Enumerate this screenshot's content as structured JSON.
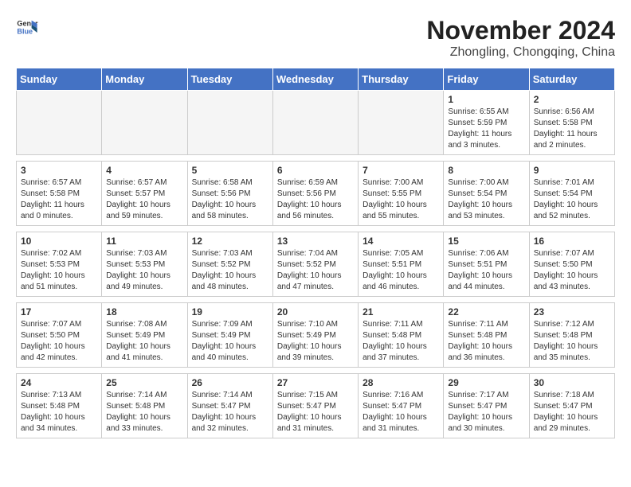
{
  "header": {
    "logo_general": "General",
    "logo_blue": "Blue",
    "month_year": "November 2024",
    "location": "Zhongling, Chongqing, China"
  },
  "weekdays": [
    "Sunday",
    "Monday",
    "Tuesday",
    "Wednesday",
    "Thursday",
    "Friday",
    "Saturday"
  ],
  "weeks": [
    [
      {
        "day": "",
        "info": ""
      },
      {
        "day": "",
        "info": ""
      },
      {
        "day": "",
        "info": ""
      },
      {
        "day": "",
        "info": ""
      },
      {
        "day": "",
        "info": ""
      },
      {
        "day": "1",
        "info": "Sunrise: 6:55 AM\nSunset: 5:59 PM\nDaylight: 11 hours\nand 3 minutes."
      },
      {
        "day": "2",
        "info": "Sunrise: 6:56 AM\nSunset: 5:58 PM\nDaylight: 11 hours\nand 2 minutes."
      }
    ],
    [
      {
        "day": "3",
        "info": "Sunrise: 6:57 AM\nSunset: 5:58 PM\nDaylight: 11 hours\nand 0 minutes."
      },
      {
        "day": "4",
        "info": "Sunrise: 6:57 AM\nSunset: 5:57 PM\nDaylight: 10 hours\nand 59 minutes."
      },
      {
        "day": "5",
        "info": "Sunrise: 6:58 AM\nSunset: 5:56 PM\nDaylight: 10 hours\nand 58 minutes."
      },
      {
        "day": "6",
        "info": "Sunrise: 6:59 AM\nSunset: 5:56 PM\nDaylight: 10 hours\nand 56 minutes."
      },
      {
        "day": "7",
        "info": "Sunrise: 7:00 AM\nSunset: 5:55 PM\nDaylight: 10 hours\nand 55 minutes."
      },
      {
        "day": "8",
        "info": "Sunrise: 7:00 AM\nSunset: 5:54 PM\nDaylight: 10 hours\nand 53 minutes."
      },
      {
        "day": "9",
        "info": "Sunrise: 7:01 AM\nSunset: 5:54 PM\nDaylight: 10 hours\nand 52 minutes."
      }
    ],
    [
      {
        "day": "10",
        "info": "Sunrise: 7:02 AM\nSunset: 5:53 PM\nDaylight: 10 hours\nand 51 minutes."
      },
      {
        "day": "11",
        "info": "Sunrise: 7:03 AM\nSunset: 5:53 PM\nDaylight: 10 hours\nand 49 minutes."
      },
      {
        "day": "12",
        "info": "Sunrise: 7:03 AM\nSunset: 5:52 PM\nDaylight: 10 hours\nand 48 minutes."
      },
      {
        "day": "13",
        "info": "Sunrise: 7:04 AM\nSunset: 5:52 PM\nDaylight: 10 hours\nand 47 minutes."
      },
      {
        "day": "14",
        "info": "Sunrise: 7:05 AM\nSunset: 5:51 PM\nDaylight: 10 hours\nand 46 minutes."
      },
      {
        "day": "15",
        "info": "Sunrise: 7:06 AM\nSunset: 5:51 PM\nDaylight: 10 hours\nand 44 minutes."
      },
      {
        "day": "16",
        "info": "Sunrise: 7:07 AM\nSunset: 5:50 PM\nDaylight: 10 hours\nand 43 minutes."
      }
    ],
    [
      {
        "day": "17",
        "info": "Sunrise: 7:07 AM\nSunset: 5:50 PM\nDaylight: 10 hours\nand 42 minutes."
      },
      {
        "day": "18",
        "info": "Sunrise: 7:08 AM\nSunset: 5:49 PM\nDaylight: 10 hours\nand 41 minutes."
      },
      {
        "day": "19",
        "info": "Sunrise: 7:09 AM\nSunset: 5:49 PM\nDaylight: 10 hours\nand 40 minutes."
      },
      {
        "day": "20",
        "info": "Sunrise: 7:10 AM\nSunset: 5:49 PM\nDaylight: 10 hours\nand 39 minutes."
      },
      {
        "day": "21",
        "info": "Sunrise: 7:11 AM\nSunset: 5:48 PM\nDaylight: 10 hours\nand 37 minutes."
      },
      {
        "day": "22",
        "info": "Sunrise: 7:11 AM\nSunset: 5:48 PM\nDaylight: 10 hours\nand 36 minutes."
      },
      {
        "day": "23",
        "info": "Sunrise: 7:12 AM\nSunset: 5:48 PM\nDaylight: 10 hours\nand 35 minutes."
      }
    ],
    [
      {
        "day": "24",
        "info": "Sunrise: 7:13 AM\nSunset: 5:48 PM\nDaylight: 10 hours\nand 34 minutes."
      },
      {
        "day": "25",
        "info": "Sunrise: 7:14 AM\nSunset: 5:48 PM\nDaylight: 10 hours\nand 33 minutes."
      },
      {
        "day": "26",
        "info": "Sunrise: 7:14 AM\nSunset: 5:47 PM\nDaylight: 10 hours\nand 32 minutes."
      },
      {
        "day": "27",
        "info": "Sunrise: 7:15 AM\nSunset: 5:47 PM\nDaylight: 10 hours\nand 31 minutes."
      },
      {
        "day": "28",
        "info": "Sunrise: 7:16 AM\nSunset: 5:47 PM\nDaylight: 10 hours\nand 31 minutes."
      },
      {
        "day": "29",
        "info": "Sunrise: 7:17 AM\nSunset: 5:47 PM\nDaylight: 10 hours\nand 30 minutes."
      },
      {
        "day": "30",
        "info": "Sunrise: 7:18 AM\nSunset: 5:47 PM\nDaylight: 10 hours\nand 29 minutes."
      }
    ]
  ]
}
